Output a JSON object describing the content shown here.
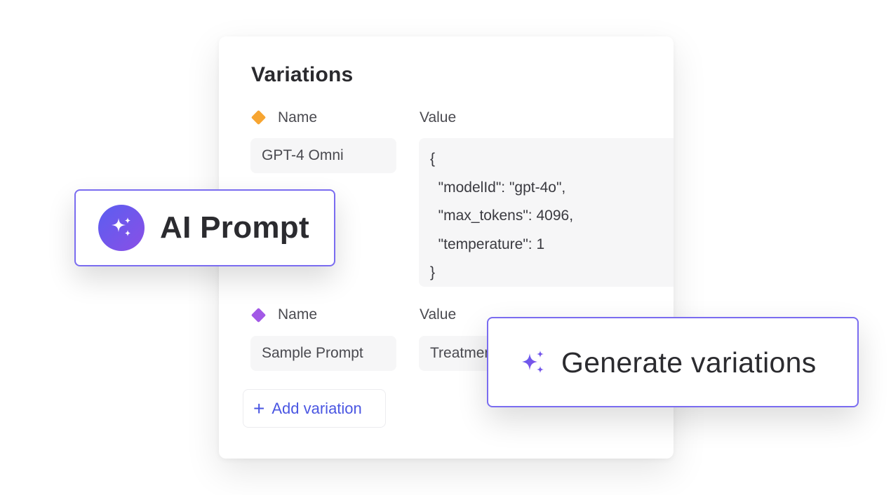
{
  "variations_card": {
    "title": "Variations",
    "rows": [
      {
        "diamond_color": "#f7a531",
        "name_label": "Name",
        "value_label": "Value",
        "name_value": "GPT-4 Omni",
        "json_lines": [
          "{",
          "  \"modelId\": \"gpt-4o\",",
          "  \"max_tokens\": 4096,",
          "  \"temperature\": 1",
          "}"
        ]
      },
      {
        "diamond_color": "#a259e6",
        "name_label": "Name",
        "value_label": "Value",
        "name_value": "Sample Prompt",
        "value_value": "Treatment"
      }
    ],
    "add_button": {
      "icon": "plus-icon",
      "label": "Add variation"
    }
  },
  "ai_prompt_chip": {
    "icon": "sparkles-icon",
    "label": "AI Prompt"
  },
  "generate_chip": {
    "icon": "sparkles-icon",
    "label": "Generate variations"
  },
  "colors": {
    "accent": "#4a56e2",
    "chip_border": "#7a6cf0",
    "gradient_start": "#5b5ef0",
    "gradient_end": "#8a4fe6"
  }
}
